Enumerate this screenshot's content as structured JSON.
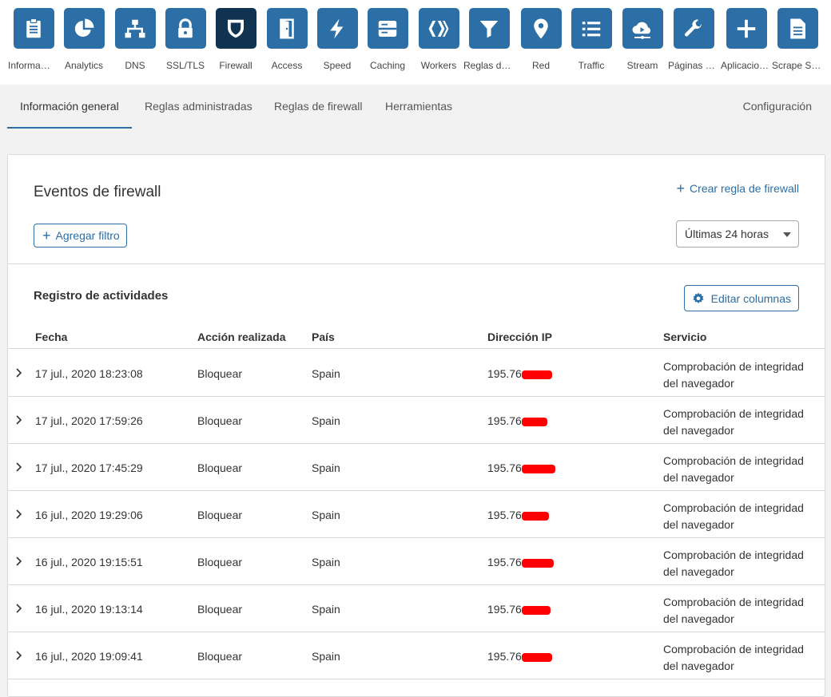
{
  "apps": [
    {
      "label": "Información general",
      "icon": "clipboard-icon"
    },
    {
      "label": "Analytics",
      "icon": "pie-chart-icon"
    },
    {
      "label": "DNS",
      "icon": "network-icon"
    },
    {
      "label": "SSL/TLS",
      "icon": "lock-icon"
    },
    {
      "label": "Firewall",
      "icon": "shield-icon",
      "active": true
    },
    {
      "label": "Access",
      "icon": "door-icon"
    },
    {
      "label": "Speed",
      "icon": "lightning-icon"
    },
    {
      "label": "Caching",
      "icon": "server-icon"
    },
    {
      "label": "Workers",
      "icon": "workers-icon"
    },
    {
      "label": "Reglas de página",
      "icon": "filter-icon"
    },
    {
      "label": "Red",
      "icon": "location-pin-icon"
    },
    {
      "label": "Traffic",
      "icon": "list-icon"
    },
    {
      "label": "Stream",
      "icon": "cloud-play-icon"
    },
    {
      "label": "Páginas personalizadas",
      "icon": "wrench-icon"
    },
    {
      "label": "Aplicaciones",
      "icon": "plus-icon"
    },
    {
      "label": "Scrape Shield",
      "icon": "document-icon"
    }
  ],
  "tabs": [
    {
      "label": "Información general",
      "active": true
    },
    {
      "label": "Reglas administradas"
    },
    {
      "label": "Reglas de firewall"
    },
    {
      "label": "Herramientas"
    }
  ],
  "config_tab": "Configuración",
  "events": {
    "title": "Eventos de firewall",
    "create_rule": "Crear regla de firewall",
    "add_filter": "Agregar filtro",
    "range": "Últimas 24 horas"
  },
  "log": {
    "title": "Registro de actividades",
    "edit_columns": "Editar columnas",
    "columns": {
      "date": "Fecha",
      "action": "Acción realizada",
      "country": "País",
      "ip": "Dirección IP",
      "service": "Servicio"
    },
    "rows": [
      {
        "date": "17 jul., 2020 18:23:08",
        "action": "Bloquear",
        "country": "Spain",
        "ip": "195.76.",
        "service_line1": "Comprobación de integridad",
        "service_line2": "del navegador"
      },
      {
        "date": "17 jul., 2020 17:59:26",
        "action": "Bloquear",
        "country": "Spain",
        "ip": "195.76.",
        "service_line1": "Comprobación de integridad",
        "service_line2": "del navegador"
      },
      {
        "date": "17 jul., 2020 17:45:29",
        "action": "Bloquear",
        "country": "Spain",
        "ip": "195.76.",
        "service_line1": "Comprobación de integridad",
        "service_line2": "del navegador"
      },
      {
        "date": "16 jul., 2020 19:29:06",
        "action": "Bloquear",
        "country": "Spain",
        "ip": "195.76.",
        "service_line1": "Comprobación de integridad",
        "service_line2": "del navegador"
      },
      {
        "date": "16 jul., 2020 19:15:51",
        "action": "Bloquear",
        "country": "Spain",
        "ip": "195.76",
        "service_line1": "Comprobación de integridad",
        "service_line2": "del navegador"
      },
      {
        "date": "16 jul., 2020 19:13:14",
        "action": "Bloquear",
        "country": "Spain",
        "ip": "195.76.",
        "service_line1": "Comprobación de integridad",
        "service_line2": "del navegador"
      },
      {
        "date": "16 jul., 2020 19:09:41",
        "action": "Bloquear",
        "country": "Spain",
        "ip": "195.76.",
        "service_line1": "Comprobación de integridad",
        "service_line2": "del navegador"
      }
    ]
  },
  "colors": {
    "accent": "#2b6fa6",
    "active_tile": "#0f3350",
    "redaction": "#ff0000"
  }
}
